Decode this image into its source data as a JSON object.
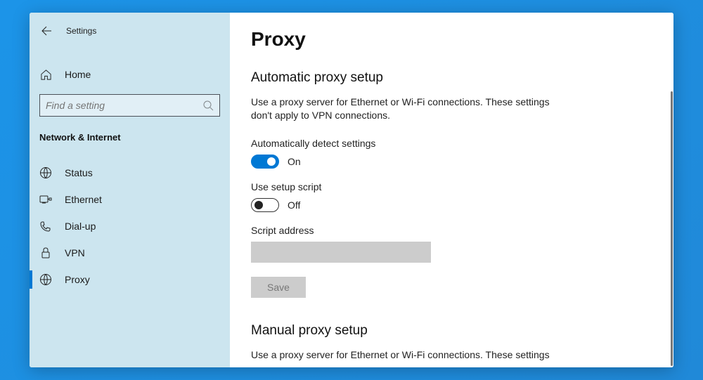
{
  "app": {
    "title": "Settings"
  },
  "sidebar": {
    "home_label": "Home",
    "search_placeholder": "Find a setting",
    "category": "Network & Internet",
    "items": [
      {
        "label": "Status",
        "icon": "status"
      },
      {
        "label": "Ethernet",
        "icon": "ethernet"
      },
      {
        "label": "Dial-up",
        "icon": "dialup"
      },
      {
        "label": "VPN",
        "icon": "vpn"
      },
      {
        "label": "Proxy",
        "icon": "proxy",
        "active": true
      }
    ]
  },
  "page": {
    "title": "Proxy",
    "auto": {
      "heading": "Automatic proxy setup",
      "description": "Use a proxy server for Ethernet or Wi-Fi connections. These settings don't apply to VPN connections.",
      "detect_label": "Automatically detect settings",
      "detect_state": "On",
      "script_label": "Use setup script",
      "script_state": "Off",
      "script_address_label": "Script address",
      "script_address_value": "",
      "save_label": "Save"
    },
    "manual": {
      "heading": "Manual proxy setup",
      "description": "Use a proxy server for Ethernet or Wi-Fi connections. These settings"
    }
  }
}
